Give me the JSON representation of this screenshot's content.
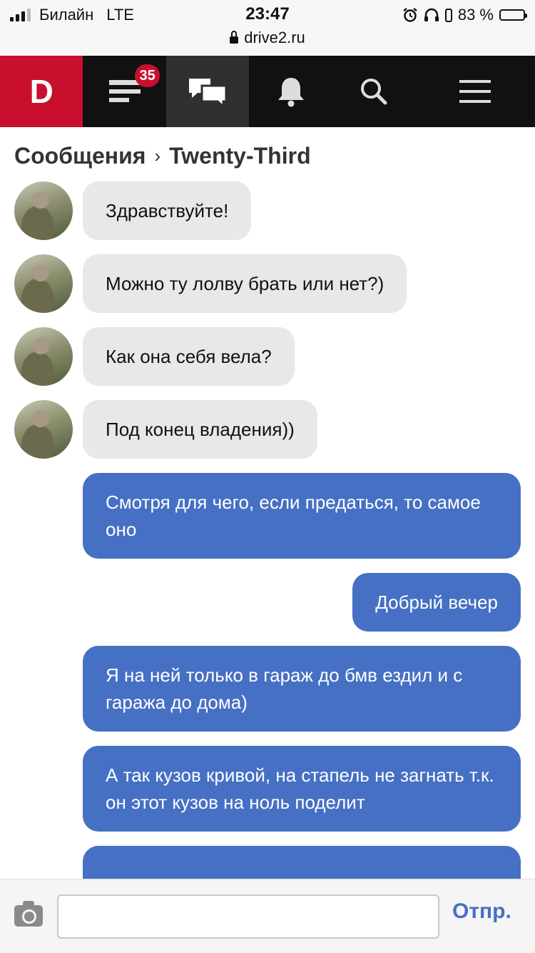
{
  "status_bar": {
    "carrier": "Билайн",
    "network": "LTE",
    "time": "23:47",
    "url": "drive2.ru",
    "battery": "83 %",
    "battery_level": 0.83
  },
  "nav": {
    "logo": "D",
    "notifications_badge": "35",
    "icons": [
      "feed-icon",
      "messages-icon",
      "bell-icon",
      "search-icon",
      "menu-icon"
    ],
    "colors": {
      "logo_bg": "#c8102e",
      "bar_bg": "#111111",
      "active_bg": "#303030"
    }
  },
  "header": {
    "section": "Сообщения",
    "separator": "›",
    "contact": "Twenty-Third"
  },
  "messages": [
    {
      "dir": "in",
      "text": "Здравствуйте!"
    },
    {
      "dir": "in",
      "text": "Можно ту лолву брать или нет?)"
    },
    {
      "dir": "in",
      "text": "Как она себя вела?"
    },
    {
      "dir": "in",
      "text": "Под конец владения))"
    },
    {
      "dir": "out",
      "text": "Смотря для чего, если предаться, то самое оно"
    },
    {
      "dir": "out",
      "text": "Добрый вечер"
    },
    {
      "dir": "out",
      "text": "Я на ней только в гараж до бмв ездил и с гаража до дома)"
    },
    {
      "dir": "out",
      "text": "А так кузов кривой, на стапель не загнать т.к. он этот кузов на ноль поделит"
    },
    {
      "dir": "out",
      "text": ""
    }
  ],
  "composer": {
    "camera_icon": "camera-icon",
    "input_value": "",
    "send_label": "Отпр."
  },
  "colors": {
    "incoming_bubble": "#e8e8e8",
    "outgoing_bubble": "#4670c4",
    "send_text": "#4670c4"
  }
}
